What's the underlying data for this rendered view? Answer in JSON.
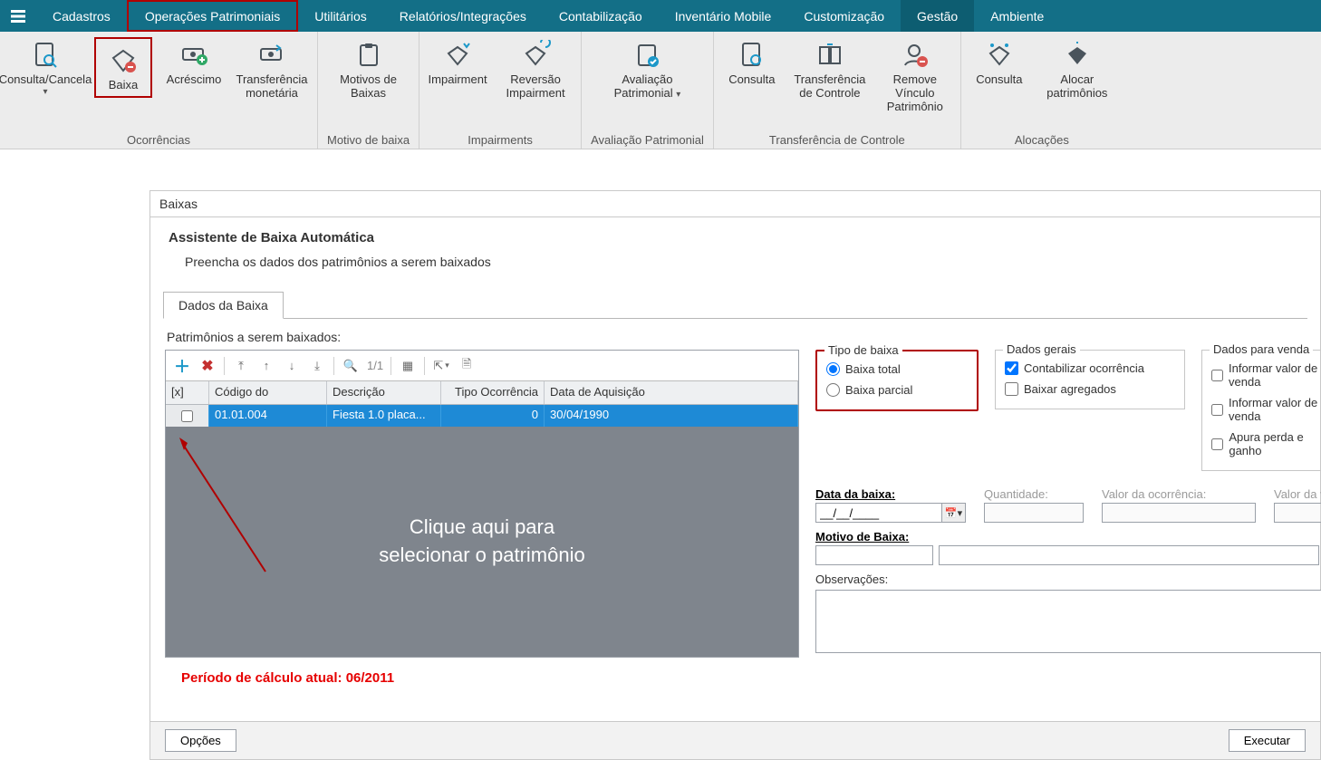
{
  "menu": {
    "items": [
      "Cadastros",
      "Operações Patrimoniais",
      "Utilitários",
      "Relatórios/Integrações",
      "Contabilização",
      "Inventário Mobile",
      "Customização",
      "Gestão",
      "Ambiente"
    ],
    "active_index": 1
  },
  "ribbon": {
    "groups": [
      {
        "label": "Ocorrências",
        "items": [
          {
            "label": "Consulta/Cancela",
            "chevron": true
          },
          {
            "label": "Baixa",
            "highlight": true
          },
          {
            "label": "Acréscimo"
          },
          {
            "label": "Transferência monetária"
          }
        ]
      },
      {
        "label": "Motivo de baixa",
        "items": [
          {
            "label": "Motivos de Baixas"
          }
        ]
      },
      {
        "label": "Impairments",
        "items": [
          {
            "label": "Impairment"
          },
          {
            "label": "Reversão Impairment"
          }
        ]
      },
      {
        "label": "Avaliação Patrimonial",
        "items": [
          {
            "label": "Avaliação Patrimonial",
            "chevron": true
          }
        ]
      },
      {
        "label": "Transferência de Controle",
        "items": [
          {
            "label": "Consulta"
          },
          {
            "label": "Transferência de Controle"
          },
          {
            "label": "Remove Vínculo Patrimônio"
          }
        ]
      },
      {
        "label": "Alocações",
        "items": [
          {
            "label": "Consulta"
          },
          {
            "label": "Alocar patrimônios"
          }
        ]
      }
    ]
  },
  "panel": {
    "title": "Baixas",
    "wizard_title": "Assistente de Baixa Automática",
    "wizard_sub": "Preencha os dados dos patrimônios a serem baixados",
    "tab_label": "Dados da Baixa",
    "grid_label": "Patrimônios a serem baixados:",
    "toolbar_page": "1/1",
    "columns": [
      "[x]",
      "Código do",
      "Descrição",
      "Tipo Ocorrência",
      "Data de Aquisição"
    ],
    "row": {
      "codigo": "01.01.004",
      "descricao": "Fiesta 1.0  placa...",
      "tipo": "0",
      "data": "30/04/1990"
    },
    "hint_line1": "Clique aqui para",
    "hint_line2": "selecionar o patrimônio",
    "period": "Período de cálculo atual: 06/2011"
  },
  "form": {
    "fs_tipo": "Tipo de baixa",
    "radio_total": "Baixa total",
    "radio_parcial": "Baixa parcial",
    "fs_gerais": "Dados gerais",
    "chk_contab": "Contabilizar ocorrência",
    "chk_agreg": "Baixar agregados",
    "fs_venda": "Dados para venda",
    "chk_venda1": "Informar valor de venda",
    "chk_venda2": "Informar valor de venda",
    "chk_apura": "Apura perda e ganho",
    "lbl_data": "Data da baixa:",
    "date_mask": "__/__/____",
    "lbl_qtd": "Quantidade:",
    "lbl_valor_ocor": "Valor da ocorrência:",
    "lbl_valor_da": "Valor da v",
    "lbl_motivo": "Motivo de Baixa:",
    "lbl_obs": "Observações:"
  },
  "footer": {
    "opcoes": "Opções",
    "executar": "Executar"
  }
}
